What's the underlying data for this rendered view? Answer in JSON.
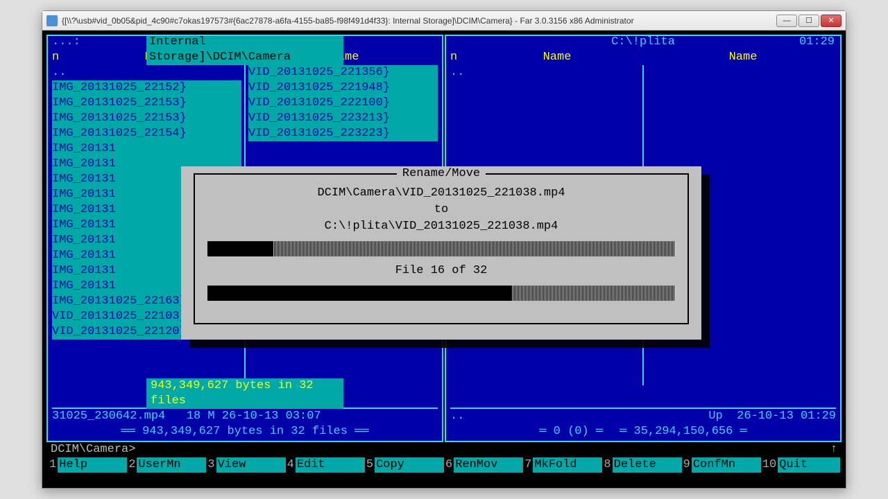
{
  "window": {
    "title": "{[\\\\?\\usb#vid_0b05&pid_4c90#c7okas197573#{6ac27878-a6fa-4155-ba85-f98f491d4f33}: Internal Storage]\\DCIM\\Camera} - Far 3.0.3156 x86 Administrator"
  },
  "clock": "01:29",
  "left_panel": {
    "caption_prefix": "...:",
    "caption": " Internal Storage]\\DCIM\\Camera ",
    "headers": {
      "n": "n",
      "name1": "Name",
      "name2": "Name"
    },
    "col1": [
      {
        "t": "..",
        "sel": false
      },
      {
        "t": "IMG_20131025_22152",
        "sel": true,
        "mark": "}"
      },
      {
        "t": "IMG_20131025_22153",
        "sel": true,
        "mark": "}"
      },
      {
        "t": "IMG_20131025_22153",
        "sel": true,
        "mark": "}"
      },
      {
        "t": "IMG_20131025_22154",
        "sel": true,
        "mark": "}"
      },
      {
        "t": "IMG_20131",
        "sel": true
      },
      {
        "t": "IMG_20131",
        "sel": true
      },
      {
        "t": "IMG_20131",
        "sel": true
      },
      {
        "t": "IMG_20131",
        "sel": true
      },
      {
        "t": "IMG_20131",
        "sel": true
      },
      {
        "t": "IMG_20131",
        "sel": true
      },
      {
        "t": "IMG_20131",
        "sel": true
      },
      {
        "t": "IMG_20131",
        "sel": true
      },
      {
        "t": "IMG_20131",
        "sel": true
      },
      {
        "t": "IMG_20131",
        "sel": true
      },
      {
        "t": "IMG_20131025_22163",
        "sel": true,
        "mark": "}"
      },
      {
        "t": "VID_20131025_22103",
        "sel": true,
        "mark": "}"
      },
      {
        "t": "VID_20131025_22120",
        "sel": true,
        "mark": "}"
      }
    ],
    "col2": [
      {
        "t": "VID_20131025_221356",
        "sel": true,
        "mark": "}"
      },
      {
        "t": "VID_20131025_221948",
        "sel": true,
        "mark": "}"
      },
      {
        "t": "VID_20131025_222100",
        "sel": true,
        "mark": "}"
      },
      {
        "t": "VID_20131025_223213",
        "sel": true,
        "mark": "}"
      },
      {
        "t": "VID_20131025_223223",
        "sel": true,
        "mark": "}"
      }
    ],
    "sel_summary": " 943,349,627 bytes in 32 files ",
    "status": "31025_230642.mp4   18 M 26-10-13 03:07",
    "footer": " 943,349,627 bytes in 32 files "
  },
  "right_panel": {
    "caption": " C:\\!plita ",
    "headers": {
      "n": "n",
      "name1": "Name",
      "name2": "Name"
    },
    "rows": [
      {
        "t": ".."
      }
    ],
    "status_left": "..",
    "status_right": "Up  26-10-13 01:29",
    "footer_left": "0 (0)",
    "footer_right": "35,294,150,656"
  },
  "cmd": {
    "prompt": "DCIM\\Camera>",
    "arrow": "↑"
  },
  "fkeys": [
    {
      "n": "1",
      "l": "Help"
    },
    {
      "n": "2",
      "l": "UserMn"
    },
    {
      "n": "3",
      "l": "View"
    },
    {
      "n": "4",
      "l": "Edit"
    },
    {
      "n": "5",
      "l": "Copy"
    },
    {
      "n": "6",
      "l": "RenMov"
    },
    {
      "n": "7",
      "l": "MkFold"
    },
    {
      "n": "8",
      "l": "Delete"
    },
    {
      "n": "9",
      "l": "ConfMn"
    },
    {
      "n": "10",
      "l": "Quit"
    }
  ],
  "dialog": {
    "title": " Rename/Move ",
    "src": "DCIM\\Camera\\VID_20131025_221038.mp4",
    "to": "to",
    "dst": "C:\\!plita\\VID_20131025_221038.mp4",
    "file_progress_pct": 14,
    "counter": "File 16 of 32",
    "total_progress_pct": 65
  }
}
